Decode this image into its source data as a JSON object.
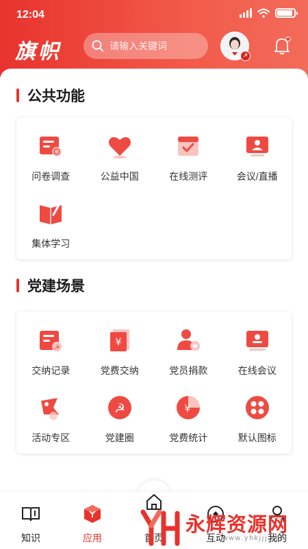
{
  "status_bar": {
    "time": "12:04",
    "battery_level": 0.9
  },
  "header": {
    "logo_text": "旗帜",
    "search_placeholder": "请输入关键词"
  },
  "colors": {
    "accent": "#e8332d",
    "accent_light": "#f36b5a",
    "text": "#333333"
  },
  "sections": [
    {
      "title": "公共功能",
      "items": [
        {
          "label": "问卷调查",
          "icon": "survey-icon"
        },
        {
          "label": "公益中国",
          "icon": "heart-icon"
        },
        {
          "label": "在线测评",
          "icon": "calendar-check-icon"
        },
        {
          "label": "会议/直播",
          "icon": "meeting-screen-icon"
        },
        {
          "label": "集体学习",
          "icon": "book-pen-icon"
        }
      ]
    },
    {
      "title": "党建场景",
      "items": [
        {
          "label": "交纳记录",
          "icon": "payment-record-icon"
        },
        {
          "label": "党费交纳",
          "icon": "yuan-bill-icon"
        },
        {
          "label": "党员捐款",
          "icon": "member-heart-icon"
        },
        {
          "label": "在线会议",
          "icon": "online-meeting-icon"
        },
        {
          "label": "活动专区",
          "icon": "flag-icon"
        },
        {
          "label": "党建圈",
          "icon": "party-emblem-icon"
        },
        {
          "label": "党费统计",
          "icon": "yuan-pie-icon"
        },
        {
          "label": "默认图标",
          "icon": "four-dots-icon"
        }
      ]
    }
  ],
  "tabbar": [
    {
      "label": "知识",
      "icon": "book-icon",
      "active": false
    },
    {
      "label": "应用",
      "icon": "apps-cube-icon",
      "active": true
    },
    {
      "label": "首页",
      "icon": "home-icon",
      "active": false
    },
    {
      "label": "互动",
      "icon": "interaction-icon",
      "active": false
    },
    {
      "label": "我的",
      "icon": "profile-icon",
      "active": false
    }
  ],
  "watermark": {
    "brand": "永辉资源网",
    "url": "www.yhkjjj.com"
  }
}
